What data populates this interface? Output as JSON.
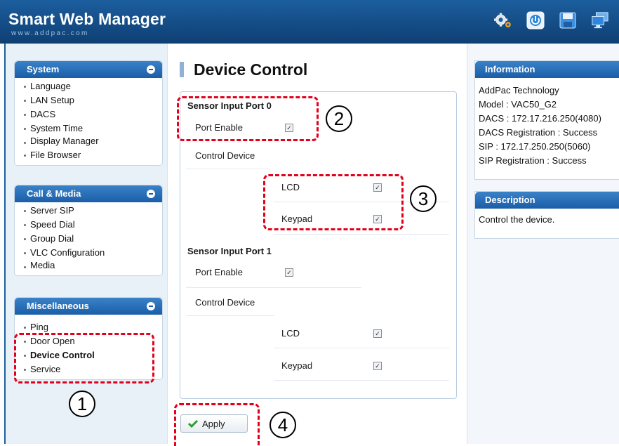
{
  "header": {
    "title": "Smart Web Manager",
    "subtitle": "www.addpac.com",
    "icons": [
      "settings-icon",
      "power-icon",
      "save-icon",
      "monitor-icon"
    ]
  },
  "sidebar": {
    "system": {
      "title": "System",
      "items": [
        "Language",
        "LAN Setup",
        "DACS",
        "System Time",
        "Display Manager",
        "File Browser"
      ]
    },
    "call_media": {
      "title": "Call & Media",
      "items": [
        "Server SIP",
        "Speed Dial",
        "Group Dial",
        "VLC Configuration",
        "Media"
      ]
    },
    "misc": {
      "title": "Miscellaneous",
      "items": [
        "Ping",
        "Door Open",
        "Device Control",
        "Service"
      ],
      "active": "Device Control"
    }
  },
  "main": {
    "title": "Device Control",
    "port0": {
      "title": "Sensor Input Port 0",
      "port_enable_label": "Port Enable",
      "port_enable_checked": true,
      "control_device_label": "Control Device",
      "lcd_label": "LCD",
      "lcd_checked": true,
      "keypad_label": "Keypad",
      "keypad_checked": true
    },
    "port1": {
      "title": "Sensor Input Port 1",
      "port_enable_label": "Port Enable",
      "port_enable_checked": true,
      "control_device_label": "Control Device",
      "lcd_label": "LCD",
      "lcd_checked": true,
      "keypad_label": "Keypad",
      "keypad_checked": true
    },
    "apply_label": "Apply"
  },
  "info": {
    "title": "Information",
    "lines": [
      "AddPac Technology",
      "Model : VAC50_G2",
      "DACS : 172.17.216.250(4080)",
      "DACS Registration : Success",
      "SIP : 172.17.250.250(5060)",
      "SIP Registration : Success"
    ]
  },
  "description": {
    "title": "Description",
    "text": "Control the device."
  },
  "callouts": [
    "1",
    "2",
    "3",
    "4"
  ],
  "colors": {
    "header_bg": "#0e3f73",
    "panel_header": "#1a5ea8",
    "callout_red": "#e3001b"
  }
}
